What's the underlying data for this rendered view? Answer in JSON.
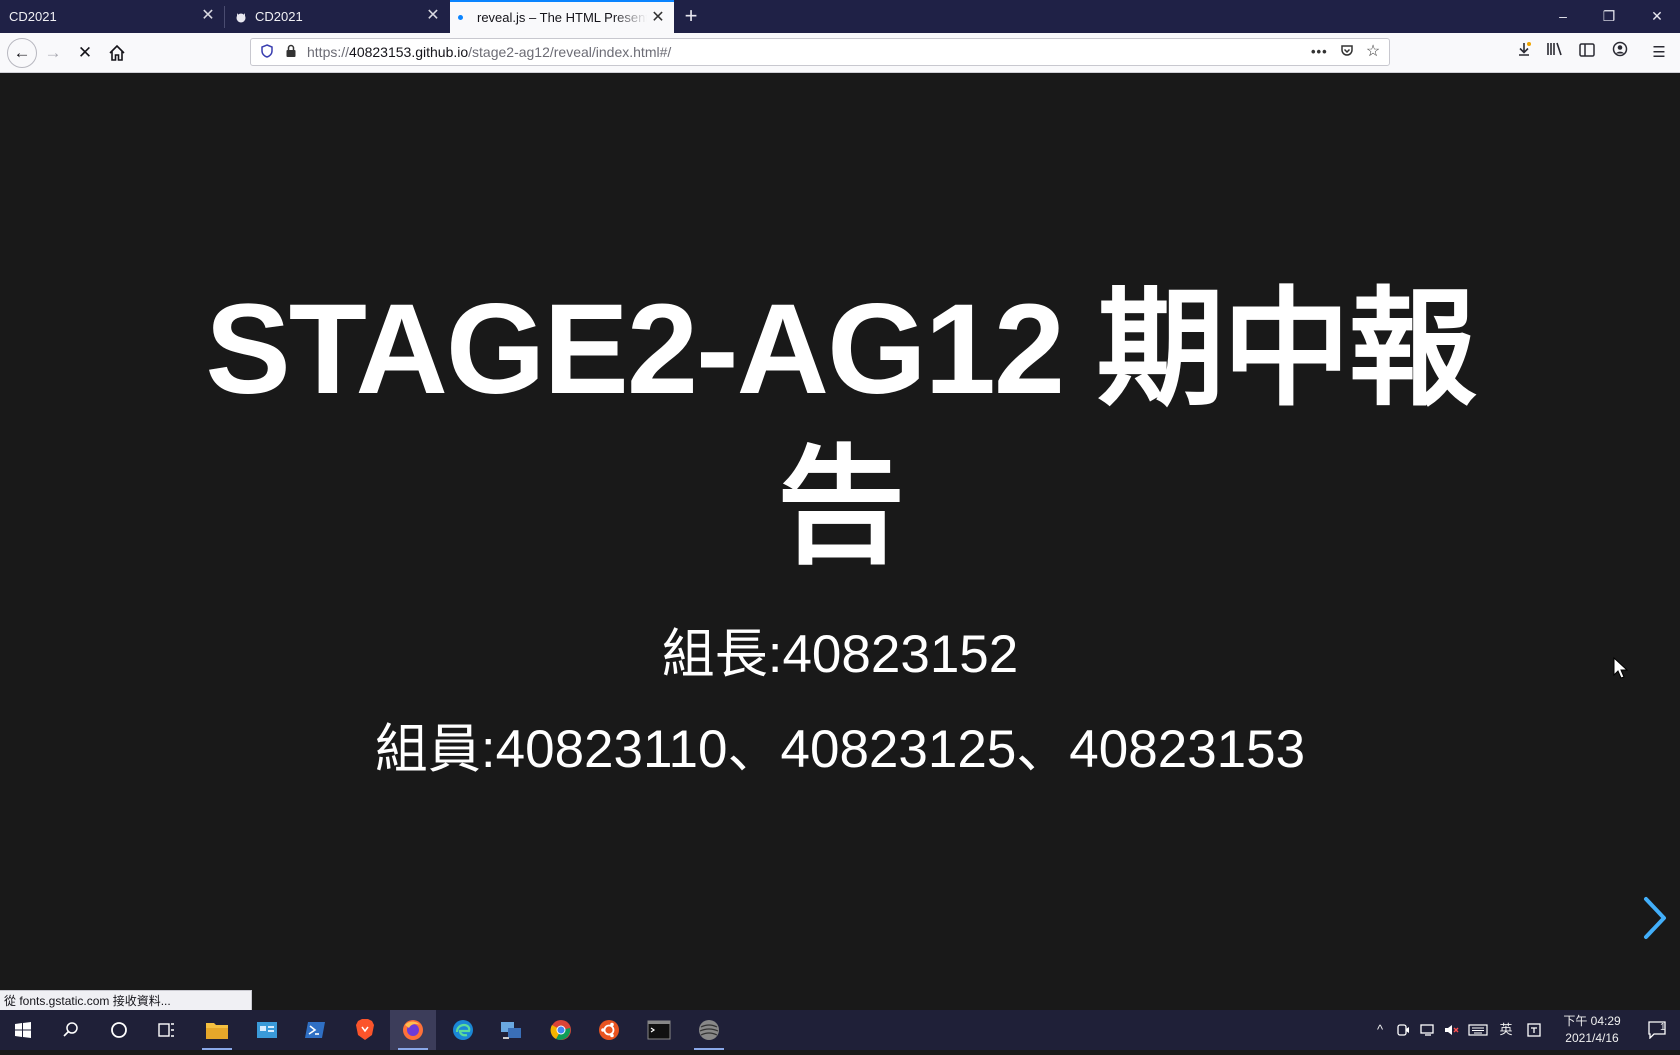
{
  "browser": {
    "tabs": [
      {
        "label": "CD2021",
        "favicon": "none",
        "active": false
      },
      {
        "label": "CD2021",
        "favicon": "github-cat-icon",
        "active": false
      },
      {
        "label": "reveal.js – The HTML Presentatio",
        "favicon": "loading-dot-icon",
        "active": true
      }
    ],
    "new_tab": "+",
    "window_controls": {
      "minimize": "–",
      "restore": "❐",
      "close": "✕"
    },
    "url": {
      "host_prefix": "https://",
      "host": "40823153.github.io",
      "path": "/stage2-ag12/reveal/index.html#/"
    },
    "status_text": "從 fonts.gstatic.com 接收資料..."
  },
  "slide": {
    "title": "STAGE2-AG12 期中報告",
    "leader": "組長:40823152",
    "members": "組員:40823110、40823125、40823153"
  },
  "taskbar": {
    "apps": [
      "start-icon",
      "search-icon",
      "cortana-icon",
      "task-view-icon",
      "file-explorer-icon",
      "control-panel-icon",
      "powershell-icon",
      "brave-icon",
      "firefox-icon",
      "edge-icon",
      "network-tool-icon",
      "chrome-icon",
      "ubuntu-icon",
      "terminal-icon",
      "app-sphere-icon"
    ],
    "ime": "英",
    "clock_time": "下午 04:29",
    "clock_date": "2021/4/16",
    "notification_count": "1"
  },
  "colors": {
    "accent": "#0a84ff",
    "slide_bg": "#191919",
    "arrow": "#42affa",
    "titlebar": "#1f2146"
  }
}
